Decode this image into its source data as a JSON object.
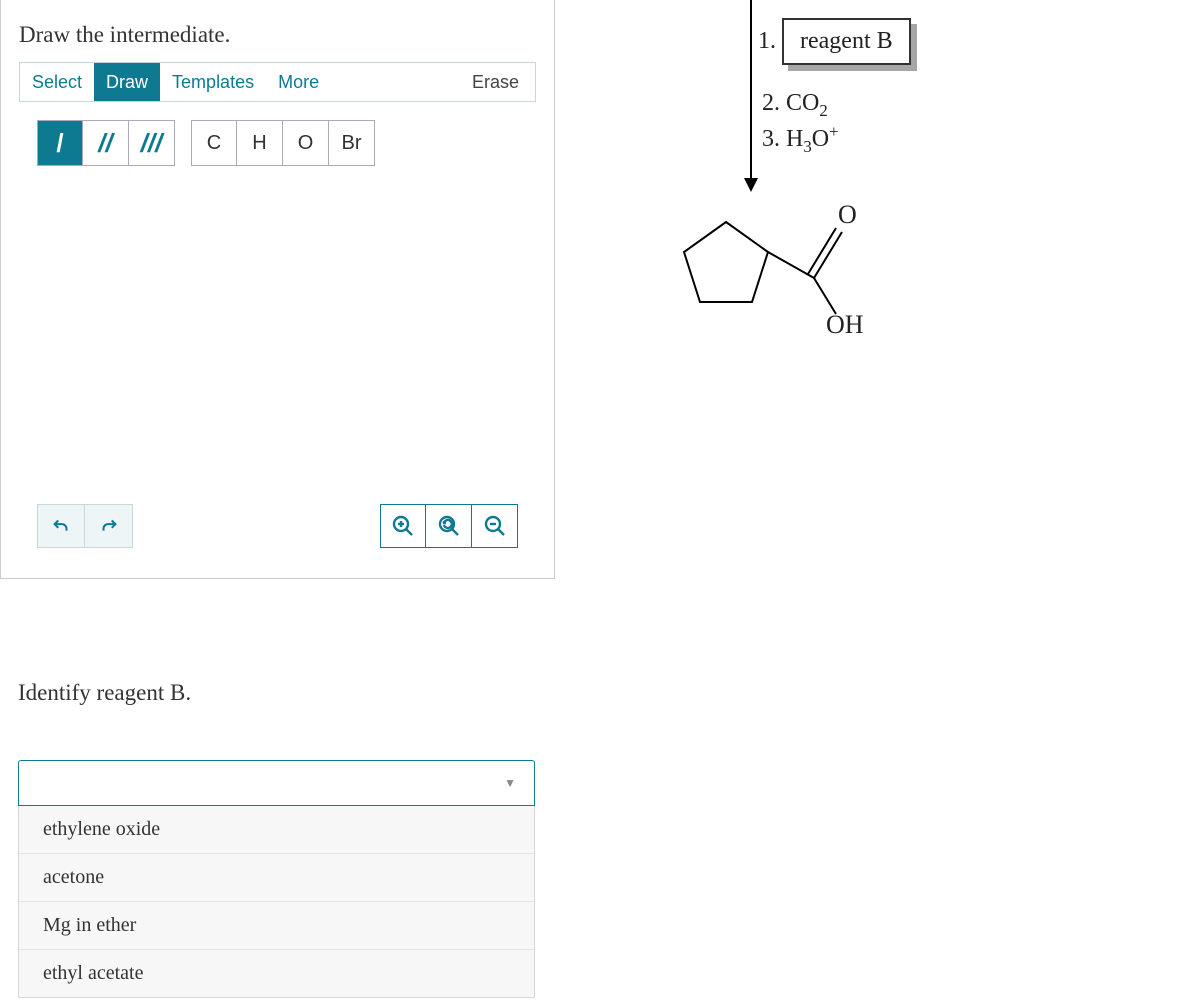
{
  "editor": {
    "prompt": "Draw the intermediate.",
    "modes": {
      "select": "Select",
      "draw": "Draw",
      "templates": "Templates",
      "more": "More"
    },
    "erase": "Erase",
    "bonds": {
      "single": "/",
      "double": "//",
      "triple": "///"
    },
    "elements": {
      "C": "C",
      "H": "H",
      "O": "O",
      "Br": "Br"
    }
  },
  "questionB": {
    "prompt": "Identify reagent B.",
    "options": [
      "ethylene oxide",
      "acetone",
      "Mg in ether",
      "ethyl acetate"
    ]
  },
  "reaction": {
    "step1_num": "1.",
    "reagent_box": "reagent B",
    "step2": "2. CO",
    "step2_sub": "2",
    "step3_a": "3. H",
    "step3_sub": "3",
    "step3_b": "O",
    "step3_sup": "+",
    "product_O": "O",
    "product_OH": "OH"
  }
}
